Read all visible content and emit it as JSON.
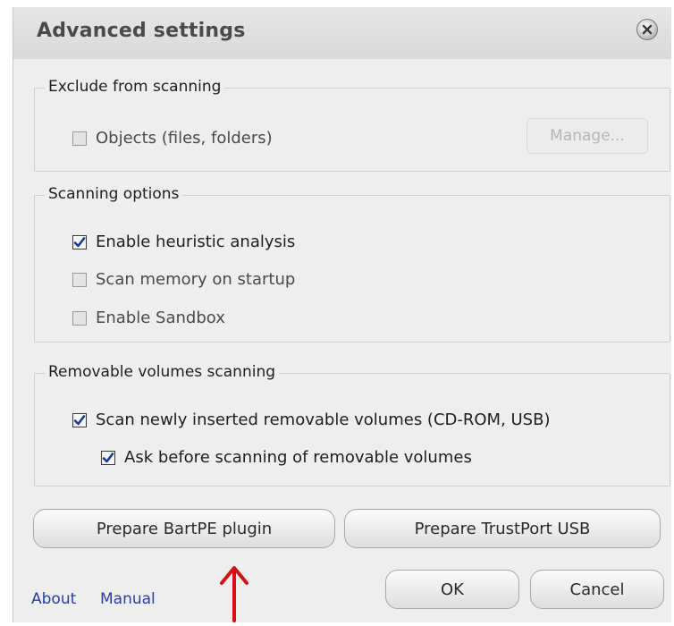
{
  "window": {
    "title": "Advanced settings",
    "close_icon": "close-icon"
  },
  "exclude": {
    "label": "Exclude from scanning",
    "objects": {
      "label": "Objects (files, folders)",
      "checked": false
    },
    "manage_button": "Manage..."
  },
  "scanning": {
    "label": "Scanning options",
    "options": [
      {
        "label": "Enable heuristic analysis",
        "checked": true
      },
      {
        "label": "Scan memory on startup",
        "checked": false
      },
      {
        "label": "Enable Sandbox",
        "checked": false
      }
    ]
  },
  "removable": {
    "label": "Removable volumes scanning",
    "options": [
      {
        "label": "Scan newly inserted removable volumes (CD-ROM, USB)",
        "checked": true
      },
      {
        "label": "Ask before scanning of removable volumes",
        "checked": true
      }
    ]
  },
  "buttons": {
    "bartpe": "Prepare BartPE plugin",
    "trustport_usb": "Prepare TrustPort USB",
    "ok": "OK",
    "cancel": "Cancel"
  },
  "links": {
    "about": "About",
    "manual": "Manual"
  },
  "annotation": {
    "icon": "red-arrow-up-icon",
    "color": "#d01414"
  },
  "colors": {
    "link": "#2a3f9e",
    "checkmark": "#1f3a8a"
  }
}
